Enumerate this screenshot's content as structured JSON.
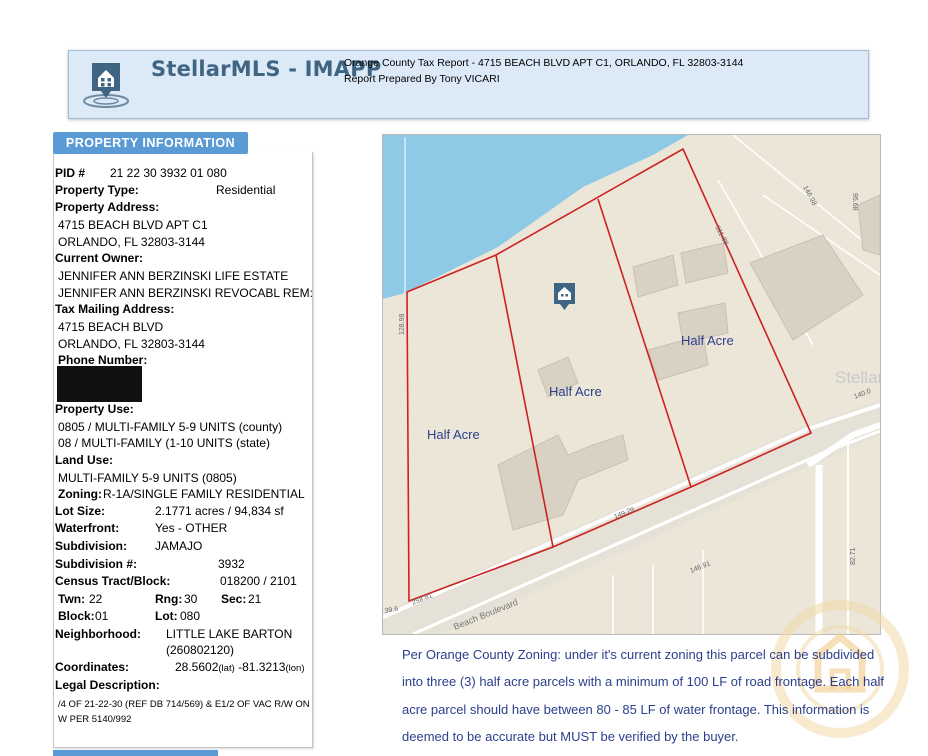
{
  "header": {
    "brand": "StellarMLS - IMAPP",
    "report_title": "Orange County Tax Report - 4715 BEACH BLVD APT C1, ORLANDO, FL 32803-3144",
    "prepared_by": "Report Prepared By Tony VICARI"
  },
  "property_info": {
    "section_title": "PROPERTY INFORMATION",
    "pid_label": "PID #",
    "pid_value": "21 22 30 3932 01 080",
    "type_label": "Property Type:",
    "type_value": "Residential",
    "address_label": "Property Address:",
    "address_line1": "4715 BEACH BLVD APT C1",
    "address_line2": "ORLANDO, FL 32803-3144",
    "owner_label": "Current Owner:",
    "owner_line1": "JENNIFER ANN BERZINSKI LIFE ESTATE",
    "owner_line2": "JENNIFER ANN BERZINSKI REVOCABL REM:",
    "mailing_label": "Tax Mailing Address:",
    "mailing_line1": "4715 BEACH BLVD",
    "mailing_line2": "ORLANDO, FL 32803-3144",
    "phone_label": "Phone Number:",
    "use_label": "Property Use:",
    "use_line1": "0805 / MULTI-FAMILY 5-9 UNITS (county)",
    "use_line2": "08 / MULTI-FAMILY (1-10 UNITS (state)",
    "land_use_label": "Land Use:",
    "land_use_value": "MULTI-FAMILY 5-9 UNITS (0805)",
    "zoning_label": "Zoning:",
    "zoning_value": "R-1A/SINGLE FAMILY RESIDENTIAL",
    "lot_size_label": "Lot Size:",
    "lot_size_value": "2.1771 acres / 94,834 sf",
    "waterfront_label": "Waterfront:",
    "waterfront_value": "Yes - OTHER",
    "subdivision_label": "Subdivision:",
    "subdivision_value": "JAMAJO",
    "subdivision_num_label": "Subdivision #:",
    "subdivision_num_value": "3932",
    "census_label": "Census Tract/Block:",
    "census_value": "018200 / 2101",
    "twn_label": "Twn:",
    "twn_value": "22",
    "rng_label": "Rng:",
    "rng_value": "30",
    "sec_label": "Sec:",
    "sec_value": "21",
    "block_label": "Block:",
    "block_value": "01",
    "lot_label": "Lot:",
    "lot_value": "080",
    "neighborhood_label": "Neighborhood:",
    "neighborhood_line1": "LITTLE LAKE BARTON",
    "neighborhood_line2": "(260802120)",
    "coords_label": "Coordinates:",
    "lat_value": "28.5602",
    "lat_unit": "(lat)",
    "lon_value": "-81.3213",
    "lon_unit": "(lon)",
    "legal_label": "Legal Description:",
    "legal_line1": "/4 OF 21-22-30 (REF DB 714/569) & E1/2 OF VAC R/W ON",
    "legal_line2": "W PER 5140/992"
  },
  "map": {
    "parcel_label_1": "Half Acre",
    "parcel_label_2": "Half Acre",
    "parcel_label_3": "Half Acre",
    "road_label": "Beach Boulevard",
    "watermark": "StellarMLS",
    "dim_left": "128.98",
    "dim_top": "311.88",
    "dim_bottom": "149.29",
    "dim_bottom_left": "258.81",
    "dim_right": "140.0",
    "dim_far_right": "146.98",
    "dim_far_bottom": "146.91",
    "dim_vertical": "82.71",
    "dim_top_right": "95.68",
    "dim_left_edge": "39.6",
    "water_color": "#8ec9e6",
    "parcel_line_color": "#cc2222"
  },
  "note": {
    "line1": "Per Orange County Zoning: under it's current zoning this parcel can be subdivided",
    "line2": "into three (3) half acre parcels with a minimum of 100 LF of road frontage. Each half",
    "line3": "acre parcel should have between 80 - 85 LF of water frontage. This information is",
    "line4": "deemed to be accurate but MUST be verified by the buyer."
  }
}
